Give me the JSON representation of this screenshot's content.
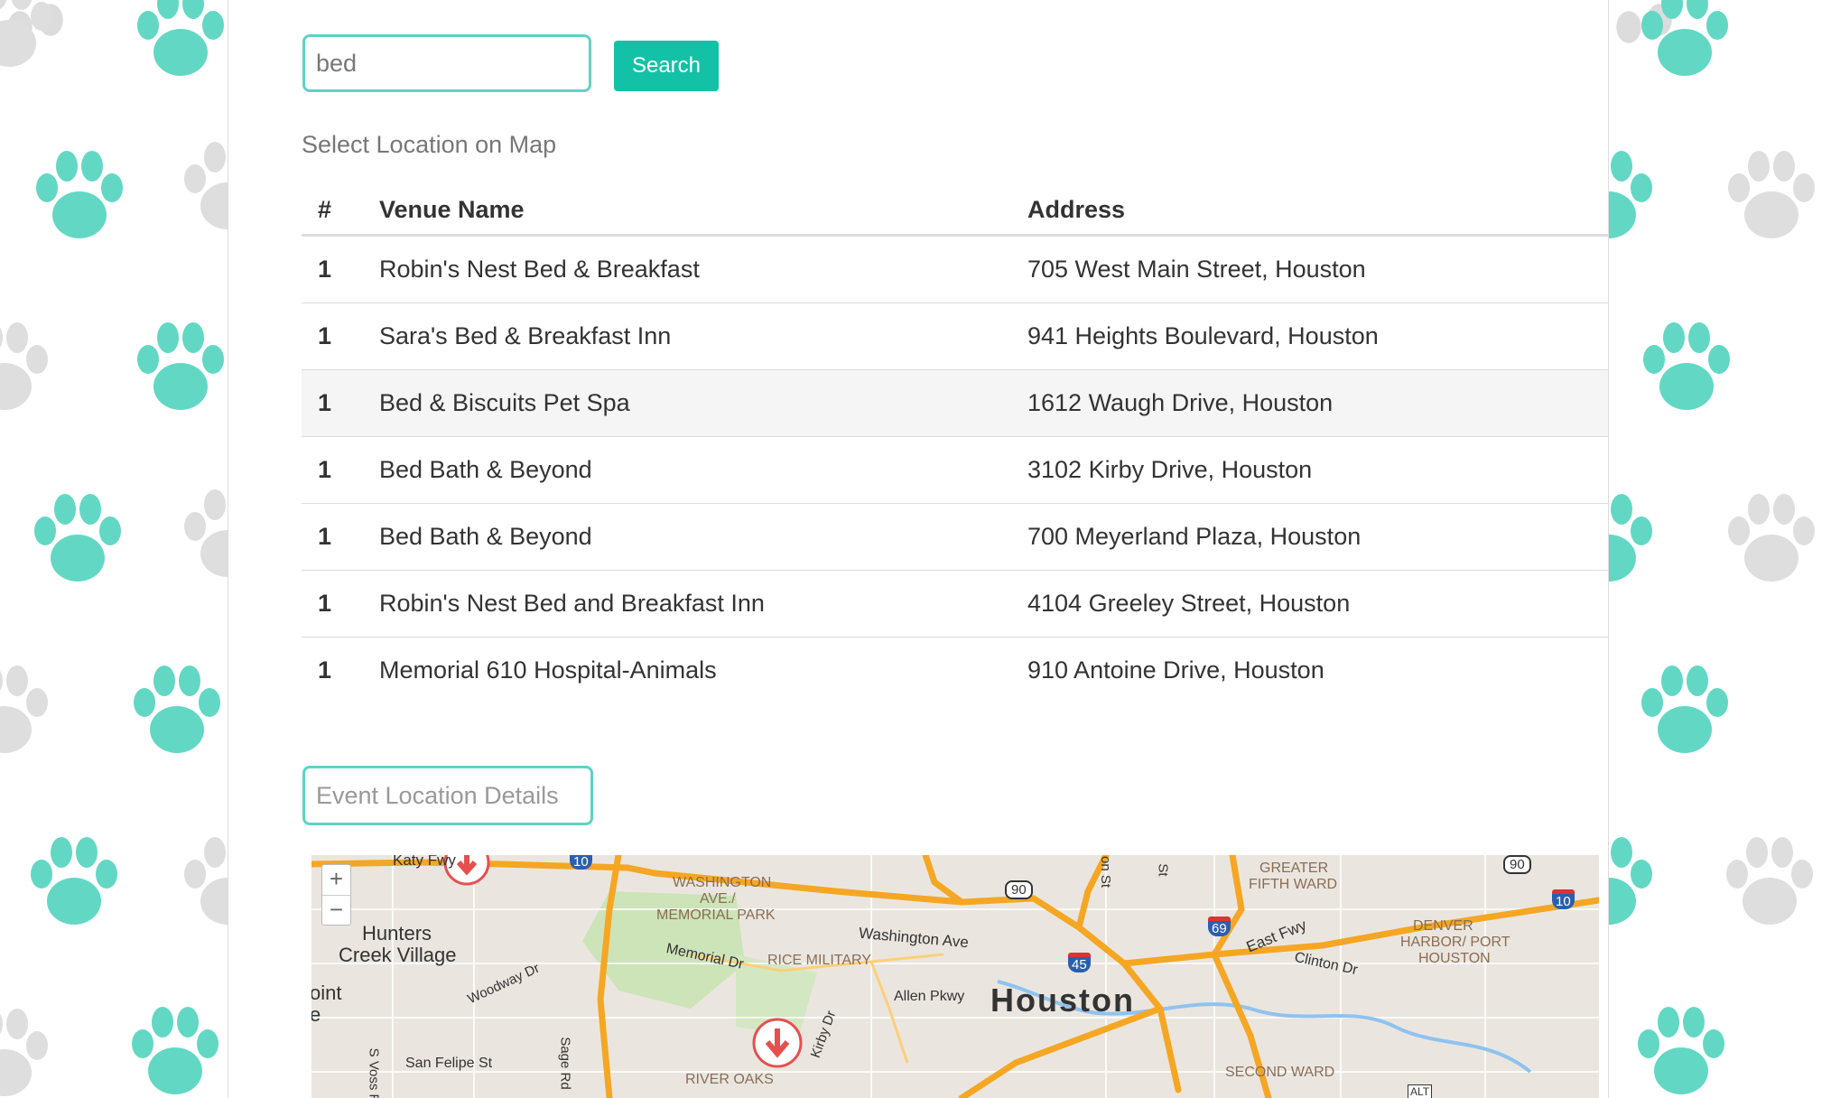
{
  "search": {
    "value": "bed",
    "button_label": "Search"
  },
  "select_location_label": "Select Location on Map",
  "table": {
    "headers": [
      "#",
      "Venue Name",
      "Address"
    ],
    "rows": [
      {
        "num": "1",
        "name": "Robin's Nest Bed & Breakfast",
        "address": "705 West Main Street, Houston"
      },
      {
        "num": "1",
        "name": "Sara's Bed & Breakfast Inn",
        "address": "941 Heights Boulevard, Houston"
      },
      {
        "num": "1",
        "name": "Bed & Biscuits Pet Spa",
        "address": "1612 Waugh Drive, Houston"
      },
      {
        "num": "1",
        "name": "Bed Bath & Beyond",
        "address": "3102 Kirby Drive, Houston"
      },
      {
        "num": "1",
        "name": "Bed Bath & Beyond",
        "address": "700 Meyerland Plaza, Houston"
      },
      {
        "num": "1",
        "name": "Robin's Nest Bed and Breakfast Inn",
        "address": "4104 Greeley Street, Houston"
      },
      {
        "num": "1",
        "name": "Memorial 610 Hospital-Animals",
        "address": "910 Antoine Drive, Houston"
      }
    ]
  },
  "event_details_label": "Event Location Details",
  "map": {
    "zoom_in": "+",
    "zoom_out": "−",
    "labels": {
      "city": "Houston",
      "hunters_creek": "Hunters",
      "hunters_creek2": "Creek Village",
      "katy_fwy": "Katy Fwy",
      "washington_ave": "WASHINGTON",
      "washington_ave2": "AVE./",
      "memorial_park": "MEMORIAL PARK",
      "washington_ave_road": "Washington Ave",
      "rice_military": "RICE MILITARY",
      "memorial_dr": "Memorial Dr",
      "allen_pkwy": "Allen Pkwy",
      "woodway_dr": "Woodway Dr",
      "kirby_dr": "Kirby Dr",
      "san_felipe": "San Felipe St",
      "sage_rd": "Sage Rd",
      "s_voss": "S Voss R",
      "river_oaks": "RIVER OAKS",
      "greater_fifth_ward": "GREATER",
      "greater_fifth_ward2": "FIFTH WARD",
      "east_fwy": "East Fwy",
      "clinton_dr": "Clinton Dr",
      "denver_harbor": "DENVER",
      "denver_harbor2": "HARBOR/ PORT",
      "denver_harbor3": "HOUSTON",
      "second_ward": "SECOND WARD",
      "point": "oint",
      "point2": "e",
      "on_st": "on St",
      "st": "St",
      "alt": "ALT",
      "shield_90a": "90",
      "shield_90b": "90",
      "shield_69": "69",
      "shield_45": "45",
      "shield_10a": "10",
      "shield_10b": "10"
    }
  },
  "colors": {
    "accent": "#13c2a6",
    "input_border": "#5fd3c2",
    "paw_teal": "#62d8c4",
    "paw_gray": "#dcdcdc",
    "highway": "#f5a623",
    "marker": "#e5504f"
  }
}
